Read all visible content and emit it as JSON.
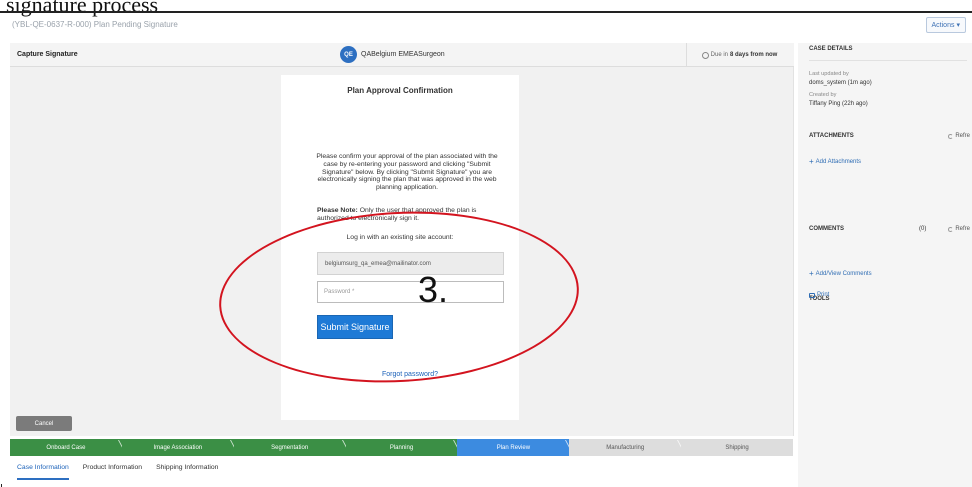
{
  "caption": {
    "text": "signature process"
  },
  "window": {
    "case_title": "(YBL-QE-0637-R-000) Plan Pending Signature",
    "actions_label": "Actions"
  },
  "header": {
    "capture_title": "Capture Signature",
    "user_initials": "QE",
    "user_name": "QABelgium EMEASurgeon",
    "due_prefix": "Due in",
    "due_value": "8 days from now"
  },
  "form": {
    "title": "Plan Approval Confirmation",
    "confirm_text": "Please confirm your approval of the plan associated with the case by re-entering your password and clicking \"Submit Signature\" below. By clicking \"Submit Signature\" you are electronically signing the plan that was approved in the web planning application.",
    "note_label": "Please Note:",
    "note_text": "Only the user that approved the plan is authorized to electronically sign it.",
    "login_label": "Log in with an existing site account:",
    "email_value": "belgiumsurg_qa_emea@mailinator.com",
    "password_placeholder": "Password *",
    "submit_label": "Submit Signature",
    "forgot_label": "Forgot password?"
  },
  "annotation": {
    "step_number": "3."
  },
  "footer": {
    "cancel_label": "Cancel"
  },
  "stepper": {
    "steps": [
      {
        "label": "Onboard Case",
        "state": "done"
      },
      {
        "label": "Image Association",
        "state": "done"
      },
      {
        "label": "Segmentation",
        "state": "done"
      },
      {
        "label": "Planning",
        "state": "done"
      },
      {
        "label": "Plan Review",
        "state": "current"
      },
      {
        "label": "Manufacturing",
        "state": "todo"
      },
      {
        "label": "Shipping",
        "state": "todo"
      }
    ]
  },
  "tabs": [
    {
      "label": "Case Information",
      "active": true
    },
    {
      "label": "Product Information",
      "active": false
    },
    {
      "label": "Shipping Information",
      "active": false
    }
  ],
  "sidebar": {
    "case_details_heading": "CASE DETAILS",
    "last_updated_label": "Last updated by",
    "last_updated_value": "doms_system (1m ago)",
    "created_label": "Created by",
    "created_value": "Tiffany Ping (22h ago)",
    "attachments_heading": "ATTACHMENTS",
    "refresh_label": "Refre",
    "add_attachments": "Add Attachments",
    "comments_heading": "COMMENTS",
    "comments_count": "(0)",
    "add_comments": "Add/View Comments",
    "tools_heading": "TOOLS",
    "print_label": "Print"
  }
}
